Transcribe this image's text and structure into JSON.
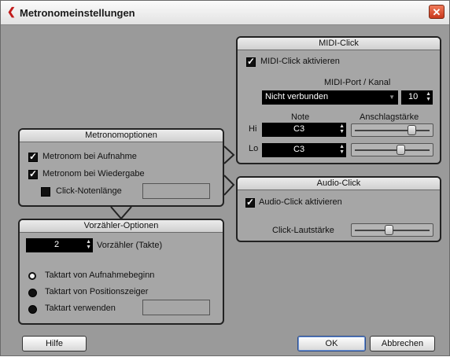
{
  "window": {
    "title": "Metronomeinstellungen",
    "close_symbol": "✕",
    "title_symbol": "❮"
  },
  "midi_click": {
    "header": "MIDI-Click",
    "activate_label": "MIDI-Click aktivieren",
    "activate_checked": true,
    "port_channel_label": "MIDI-Port / Kanal",
    "port_value": "Nicht verbunden",
    "channel_value": "10",
    "note_label": "Note",
    "velocity_label": "Anschlagstärke",
    "hi_label": "Hi",
    "lo_label": "Lo",
    "hi_note": "C3",
    "lo_note": "C3",
    "hi_velocity_fraction": 0.78,
    "lo_velocity_fraction": 0.62
  },
  "audio_click": {
    "header": "Audio-Click",
    "activate_label": "Audio-Click aktivieren",
    "activate_checked": true,
    "volume_label": "Click-Lautstärke",
    "volume_fraction": 0.45
  },
  "metronome_options": {
    "header": "Metronomoptionen",
    "record_label": "Metronom bei Aufnahme",
    "record_checked": true,
    "playback_label": "Metronom bei Wiedergabe",
    "playback_checked": true,
    "notelength_label": "Click-Notenlänge",
    "notelength_checked": false
  },
  "precount": {
    "header": "Vorzähler-Optionen",
    "bars_value": "2",
    "bars_label": "Vorzähler (Takte)",
    "options": [
      {
        "label": "Taktart von Aufnahmebeginn",
        "selected": true
      },
      {
        "label": "Taktart von Positionszeiger",
        "selected": false
      },
      {
        "label": "Taktart verwenden",
        "selected": false
      }
    ]
  },
  "buttons": {
    "help": "Hilfe",
    "ok": "OK",
    "cancel": "Abbrechen"
  }
}
